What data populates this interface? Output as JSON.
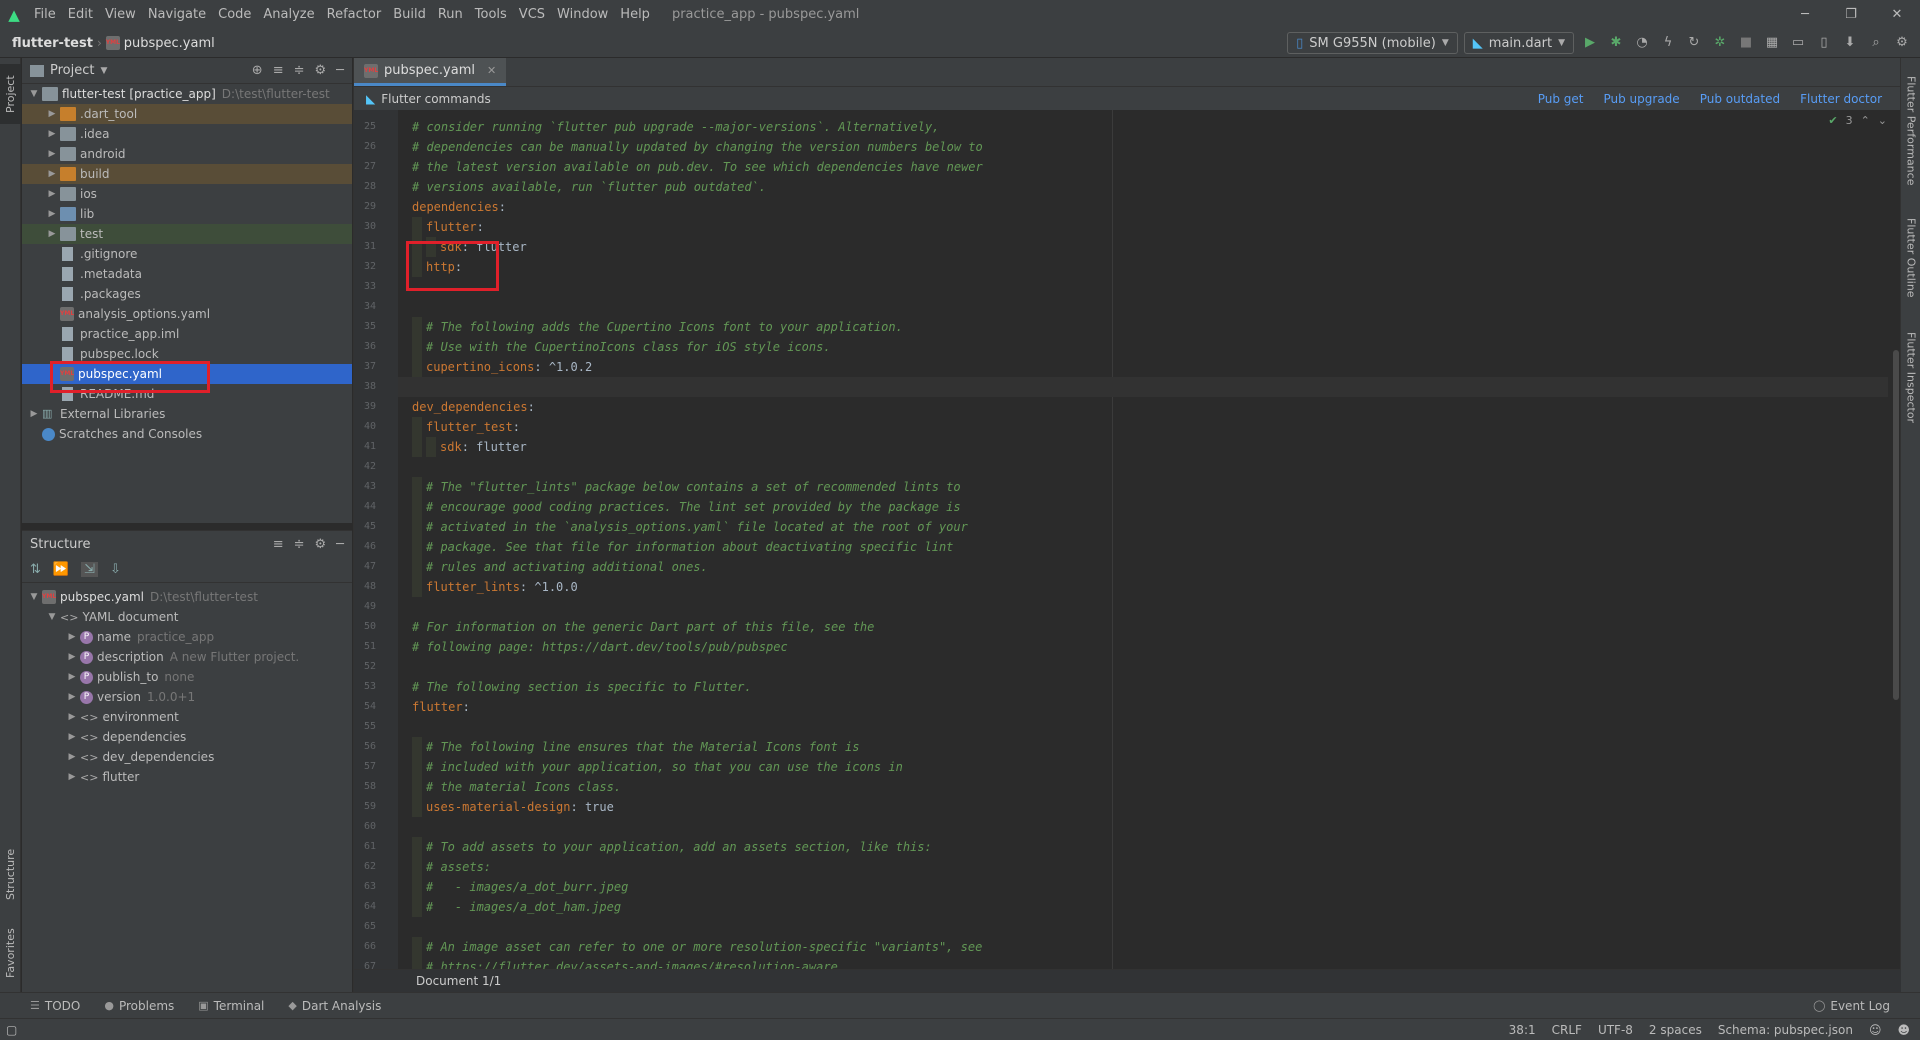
{
  "menu": {
    "items": [
      "File",
      "Edit",
      "View",
      "Navigate",
      "Code",
      "Analyze",
      "Refactor",
      "Build",
      "Run",
      "Tools",
      "VCS",
      "Window",
      "Help"
    ],
    "window_title": "practice_app - pubspec.yaml"
  },
  "nav": {
    "project": "flutter-test",
    "file": "pubspec.yaml",
    "device": "SM G955N (mobile)",
    "run_config": "main.dart"
  },
  "project_panel": {
    "title": "Project",
    "root_name": "flutter-test [practice_app]",
    "root_path": "D:\\test\\flutter-test",
    "items": [
      {
        "label": ".dart_tool",
        "kind": "folder-orange"
      },
      {
        "label": ".idea",
        "kind": "folder"
      },
      {
        "label": "android",
        "kind": "folder"
      },
      {
        "label": "build",
        "kind": "folder-orange"
      },
      {
        "label": "ios",
        "kind": "folder"
      },
      {
        "label": "lib",
        "kind": "folder-blue"
      },
      {
        "label": "test",
        "kind": "folder-green"
      },
      {
        "label": ".gitignore",
        "kind": "file"
      },
      {
        "label": ".metadata",
        "kind": "file"
      },
      {
        "label": ".packages",
        "kind": "file"
      },
      {
        "label": "analysis_options.yaml",
        "kind": "yaml"
      },
      {
        "label": "practice_app.iml",
        "kind": "file"
      },
      {
        "label": "pubspec.lock",
        "kind": "file"
      },
      {
        "label": "pubspec.yaml",
        "kind": "yaml"
      },
      {
        "label": "README.md",
        "kind": "file"
      }
    ],
    "external_libraries": "External Libraries",
    "scratches": "Scratches and Consoles"
  },
  "structure_panel": {
    "title": "Structure",
    "file": "pubspec.yaml",
    "path": "D:\\test\\flutter-test",
    "doc": "YAML document",
    "props": [
      {
        "name": "name",
        "value": "practice_app"
      },
      {
        "name": "description",
        "value": "A new Flutter project."
      },
      {
        "name": "publish_to",
        "value": "none"
      },
      {
        "name": "version",
        "value": "1.0.0+1"
      }
    ],
    "maps": [
      "environment",
      "dependencies",
      "dev_dependencies",
      "flutter"
    ]
  },
  "editor": {
    "tab": "pubspec.yaml",
    "commands_label": "Flutter commands",
    "links": [
      "Pub get",
      "Pub upgrade",
      "Pub outdated",
      "Flutter doctor"
    ],
    "inspections": "3",
    "footer": "Document 1/1",
    "lines": [
      {
        "n": "25",
        "t": "# consider running `flutter pub upgrade --major-versions`. Alternatively,",
        "c": "cm",
        "i": 0
      },
      {
        "n": "26",
        "t": "# dependencies can be manually updated by changing the version numbers below to",
        "c": "cm",
        "i": 0
      },
      {
        "n": "27",
        "t": "# the latest version available on pub.dev. To see which dependencies have newer",
        "c": "cm",
        "i": 0
      },
      {
        "n": "28",
        "t": "# versions available, run `flutter pub outdated`.",
        "c": "cm",
        "i": 0
      },
      {
        "n": "29",
        "k": "dependencies",
        "v": "",
        "i": 0
      },
      {
        "n": "30",
        "k": "flutter",
        "v": "",
        "i": 1
      },
      {
        "n": "31",
        "k": "sdk",
        "v": " flutter",
        "i": 2
      },
      {
        "n": "32",
        "k": "http",
        "v": "",
        "i": 1
      },
      {
        "n": "33",
        "t": "",
        "i": 0
      },
      {
        "n": "34",
        "t": "",
        "i": 0
      },
      {
        "n": "35",
        "t": "# The following adds the Cupertino Icons font to your application.",
        "c": "cm",
        "i": 1
      },
      {
        "n": "36",
        "t": "# Use with the CupertinoIcons class for iOS style icons.",
        "c": "cm",
        "i": 1
      },
      {
        "n": "37",
        "k": "cupertino_icons",
        "v": " ^1.0.2",
        "i": 1
      },
      {
        "n": "38",
        "t": "",
        "i": 0
      },
      {
        "n": "39",
        "k": "dev_dependencies",
        "v": "",
        "i": 0
      },
      {
        "n": "40",
        "k": "flutter_test",
        "v": "",
        "i": 1
      },
      {
        "n": "41",
        "k": "sdk",
        "v": " flutter",
        "i": 2
      },
      {
        "n": "42",
        "t": "",
        "i": 0
      },
      {
        "n": "43",
        "t": "# The \"flutter_lints\" package below contains a set of recommended lints to",
        "c": "cm",
        "i": 1
      },
      {
        "n": "44",
        "t": "# encourage good coding practices. The lint set provided by the package is",
        "c": "cm",
        "i": 1
      },
      {
        "n": "45",
        "t": "# activated in the `analysis_options.yaml` file located at the root of your",
        "c": "cm",
        "i": 1
      },
      {
        "n": "46",
        "t": "# package. See that file for information about deactivating specific lint",
        "c": "cm",
        "i": 1
      },
      {
        "n": "47",
        "t": "# rules and activating additional ones.",
        "c": "cm",
        "i": 1
      },
      {
        "n": "48",
        "k": "flutter_lints",
        "v": " ^1.0.0",
        "i": 1
      },
      {
        "n": "49",
        "t": "",
        "i": 0
      },
      {
        "n": "50",
        "t": "# For information on the generic Dart part of this file, see the",
        "c": "cm",
        "i": 0
      },
      {
        "n": "51",
        "t": "# following page: https://dart.dev/tools/pub/pubspec",
        "c": "cm",
        "i": 0
      },
      {
        "n": "52",
        "t": "",
        "i": 0
      },
      {
        "n": "53",
        "t": "# The following section is specific to Flutter.",
        "c": "cm",
        "i": 0
      },
      {
        "n": "54",
        "k": "flutter",
        "v": "",
        "i": 0
      },
      {
        "n": "55",
        "t": "",
        "i": 0
      },
      {
        "n": "56",
        "t": "# The following line ensures that the Material Icons font is",
        "c": "cm",
        "i": 1
      },
      {
        "n": "57",
        "t": "# included with your application, so that you can use the icons in",
        "c": "cm",
        "i": 1
      },
      {
        "n": "58",
        "t": "# the material Icons class.",
        "c": "cm",
        "i": 1
      },
      {
        "n": "59",
        "k": "uses-material-design",
        "v": " true",
        "i": 1
      },
      {
        "n": "60",
        "t": "",
        "i": 0
      },
      {
        "n": "61",
        "t": "# To add assets to your application, add an assets section, like this:",
        "c": "cm",
        "i": 1
      },
      {
        "n": "62",
        "t": "# assets:",
        "c": "cm",
        "i": 1
      },
      {
        "n": "63",
        "t": "#   - images/a_dot_burr.jpeg",
        "c": "cm",
        "i": 1
      },
      {
        "n": "64",
        "t": "#   - images/a_dot_ham.jpeg",
        "c": "cm",
        "i": 1
      },
      {
        "n": "65",
        "t": "",
        "i": 0
      },
      {
        "n": "66",
        "t": "# An image asset can refer to one or more resolution-specific \"variants\", see",
        "c": "cm",
        "i": 1
      },
      {
        "n": "67",
        "t": "# https://flutter.dev/assets-and-images/#resolution-aware",
        "c": "cm",
        "i": 1
      }
    ]
  },
  "right_tabs": [
    "Flutter Performance",
    "Flutter Outline",
    "Flutter Inspector"
  ],
  "left_tabs": [
    "Project",
    "Structure",
    "Favorites"
  ],
  "bottom_tabs": [
    "TODO",
    "Problems",
    "Terminal",
    "Dart Analysis"
  ],
  "event_log": "Event Log",
  "status": {
    "position": "38:1",
    "line_sep": "CRLF",
    "encoding": "UTF-8",
    "indent": "2 spaces",
    "schema": "Schema: pubspec.json"
  }
}
